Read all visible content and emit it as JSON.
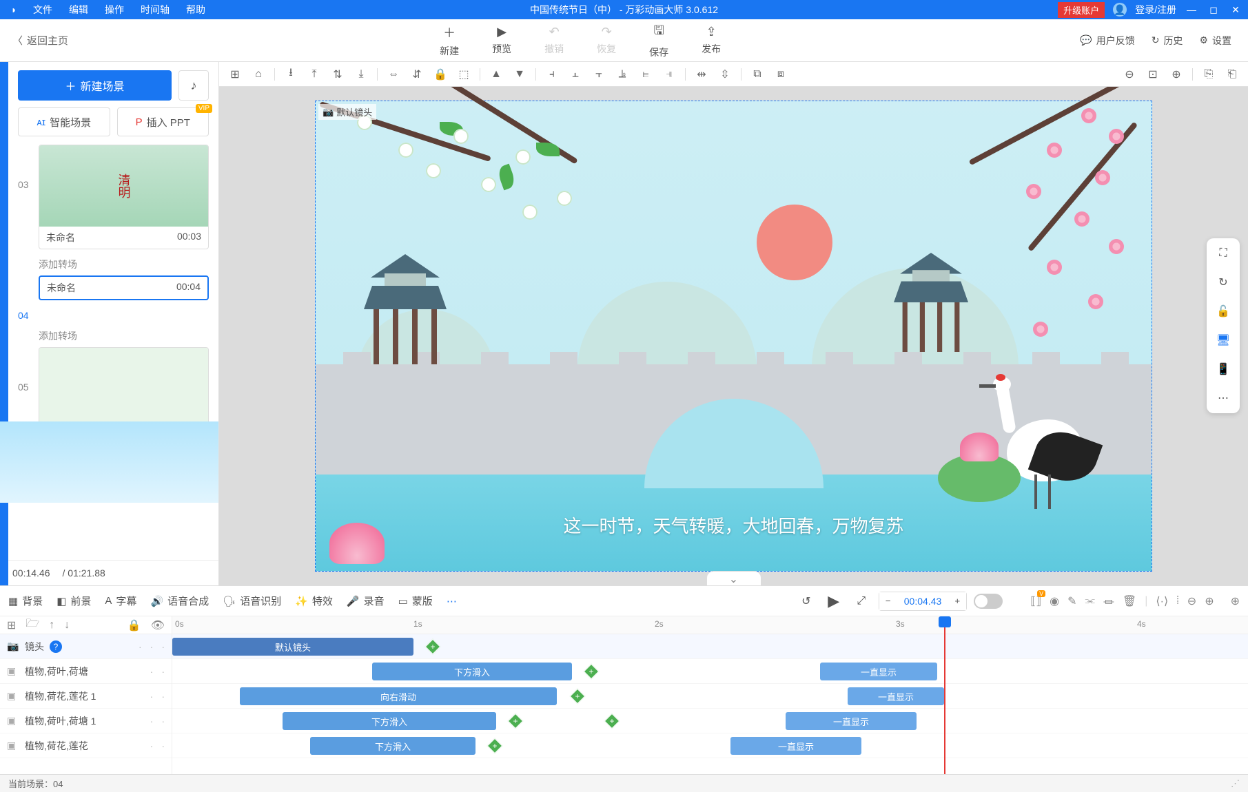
{
  "titlebar": {
    "menus": [
      "文件",
      "编辑",
      "操作",
      "时间轴",
      "帮助"
    ],
    "title": "中国传统节日（中）  - 万彩动画大师 3.0.612",
    "upgrade": "升级账户",
    "login": "登录/注册"
  },
  "toolbar": {
    "back": "返回主页",
    "buttons": [
      {
        "icon": "＋",
        "label": "新建"
      },
      {
        "icon": "▶",
        "label": "预览"
      },
      {
        "icon": "↶",
        "label": "撤销",
        "disabled": true
      },
      {
        "icon": "↷",
        "label": "恢复",
        "disabled": true
      },
      {
        "icon": "🖫",
        "label": "保存"
      },
      {
        "icon": "⇪",
        "label": "发布"
      }
    ],
    "right": [
      {
        "icon": "💬",
        "label": "用户反馈"
      },
      {
        "icon": "↻",
        "label": "历史"
      },
      {
        "icon": "⚙",
        "label": "设置"
      }
    ]
  },
  "left": {
    "newscene": "新建场景",
    "ai": "智能场景",
    "ppt": "插入 PPT",
    "vip": "VIP",
    "transition": "添加转场",
    "scenes": [
      {
        "num": "03",
        "name": "未命名",
        "time": "00:03",
        "thumb": "green"
      },
      {
        "num": "04",
        "name": "未命名",
        "time": "00:04",
        "thumb": "bridge",
        "selected": true
      },
      {
        "num": "05",
        "name": "",
        "time": "",
        "thumb": "blank"
      }
    ],
    "currenttime": "00:14.46",
    "totaltime": "/ 01:21.88"
  },
  "canvas": {
    "defaultcam": "默认镜头",
    "caption": "这一时节，天气转暖，大地回春，万物复苏"
  },
  "tl_toolbar": {
    "tabs": [
      {
        "icon": "▦",
        "label": "背景"
      },
      {
        "icon": "◧",
        "label": "前景"
      },
      {
        "icon": "A",
        "label": "字幕"
      },
      {
        "icon": "🔊",
        "label": "语音合成"
      },
      {
        "icon": "🗣",
        "label": "语音识别"
      },
      {
        "icon": "✨",
        "label": "特效"
      },
      {
        "icon": "🎤",
        "label": "录音"
      },
      {
        "icon": "▭",
        "label": "蒙版"
      }
    ],
    "time": "00:04.43"
  },
  "tracks": {
    "camera": "镜头",
    "items": [
      "植物,荷叶,荷塘",
      "植物,荷花,莲花 1",
      "植物,荷叶,荷塘 1",
      "植物,荷花,莲花"
    ]
  },
  "ruler": [
    "0s",
    "1s",
    "2s",
    "3s",
    "4s"
  ],
  "clips": {
    "camera": "默认镜头",
    "row1a": "下方滑入",
    "row1b": "一直显示",
    "row2a": "向右滑动",
    "row2b": "一直显示",
    "row3a": "下方滑入",
    "row3b": "一直显示",
    "row4a": "下方滑入",
    "row4b": "一直显示"
  },
  "status": {
    "scene": "当前场景：04"
  }
}
